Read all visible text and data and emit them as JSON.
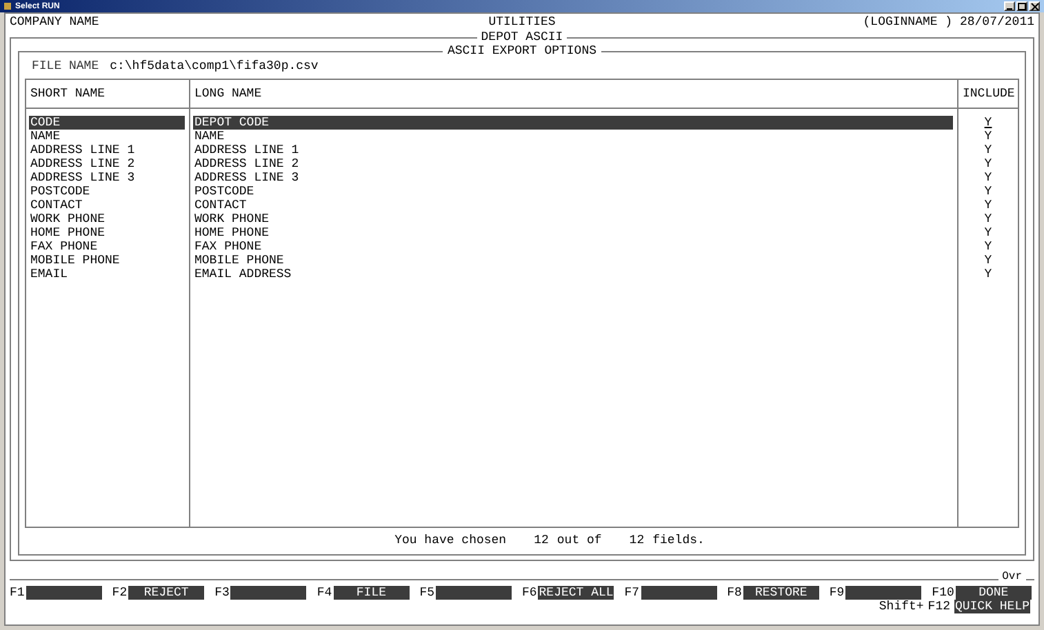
{
  "window": {
    "title": "Select RUN"
  },
  "header": {
    "company": "COMPANY NAME",
    "module": "UTILITIES",
    "user": "(LOGINNAME )",
    "date": "28/07/2011"
  },
  "screen_title": "DEPOT ASCII",
  "panel_title": "ASCII EXPORT OPTIONS",
  "file": {
    "label": "FILE NAME",
    "value": "c:\\hf5data\\comp1\\fifa30p.csv"
  },
  "table": {
    "columns": [
      "SHORT NAME",
      "LONG NAME",
      "INCLUDE"
    ],
    "rows": [
      {
        "short": "CODE",
        "long": "DEPOT CODE",
        "include": "Y",
        "selected": true
      },
      {
        "short": "NAME",
        "long": "NAME",
        "include": "Y",
        "selected": false
      },
      {
        "short": "ADDRESS LINE 1",
        "long": "ADDRESS LINE 1",
        "include": "Y",
        "selected": false
      },
      {
        "short": "ADDRESS LINE 2",
        "long": "ADDRESS LINE 2",
        "include": "Y",
        "selected": false
      },
      {
        "short": "ADDRESS LINE 3",
        "long": "ADDRESS LINE 3",
        "include": "Y",
        "selected": false
      },
      {
        "short": "POSTCODE",
        "long": "POSTCODE",
        "include": "Y",
        "selected": false
      },
      {
        "short": "CONTACT",
        "long": "CONTACT",
        "include": "Y",
        "selected": false
      },
      {
        "short": "WORK PHONE",
        "long": "WORK PHONE",
        "include": "Y",
        "selected": false
      },
      {
        "short": "HOME PHONE",
        "long": "HOME PHONE",
        "include": "Y",
        "selected": false
      },
      {
        "short": "FAX PHONE",
        "long": "FAX PHONE",
        "include": "Y",
        "selected": false
      },
      {
        "short": "MOBILE PHONE",
        "long": "MOBILE PHONE",
        "include": "Y",
        "selected": false
      },
      {
        "short": "EMAIL",
        "long": "EMAIL ADDRESS",
        "include": "Y",
        "selected": false
      }
    ]
  },
  "summary": {
    "prefix": "You have chosen",
    "chosen": "12",
    "middle": "out of",
    "total": "12",
    "suffix": "fields."
  },
  "mode": "Ovr",
  "function_keys": [
    {
      "key": "F1"
    },
    {
      "key": "F2",
      "label": "REJECT"
    },
    {
      "key": "F3"
    },
    {
      "key": "F4",
      "label": "FILE"
    },
    {
      "key": "F5"
    },
    {
      "key": "F6",
      "label": "REJECT ALL"
    },
    {
      "key": "F7"
    },
    {
      "key": "F8",
      "label": "RESTORE"
    },
    {
      "key": "F9"
    },
    {
      "key": "F10",
      "label": "DONE"
    }
  ],
  "shift_key": {
    "prefix": "Shift+",
    "key": "F12",
    "label": "QUICK HELP"
  }
}
